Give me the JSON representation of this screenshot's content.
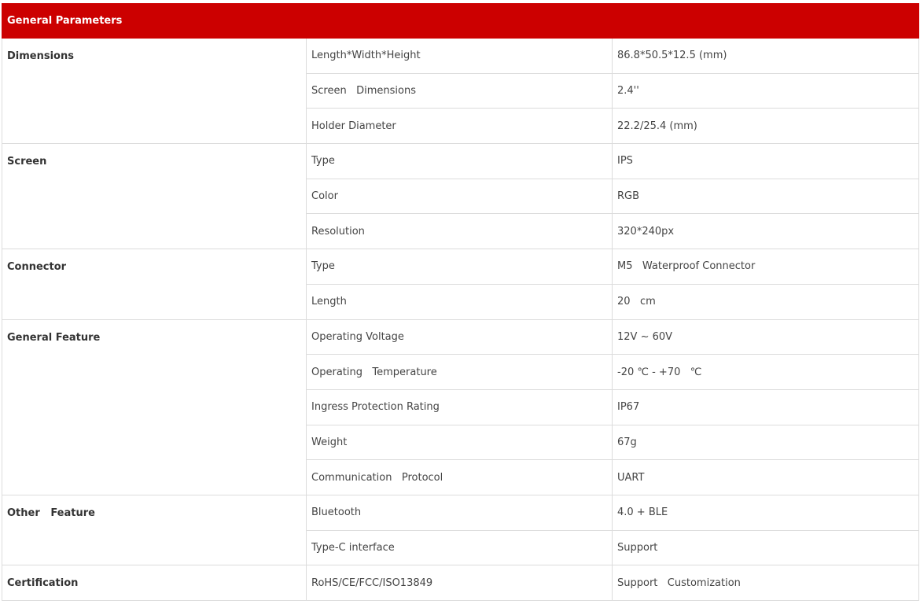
{
  "table": {
    "title": "General Parameters",
    "groups": [
      {
        "name": "Dimensions",
        "rows": [
          {
            "param": "Length*Width*Height",
            "value": "86.8*50.5*12.5 (mm)"
          },
          {
            "param": "Screen   Dimensions",
            "value": "2.4''"
          },
          {
            "param": "Holder Diameter",
            "value": "22.2/25.4 (mm)"
          }
        ]
      },
      {
        "name": "Screen",
        "rows": [
          {
            "param": "Type",
            "value": "IPS"
          },
          {
            "param": "Color",
            "value": "RGB"
          },
          {
            "param": "Resolution",
            "value": "320*240px"
          }
        ]
      },
      {
        "name": "Connector",
        "rows": [
          {
            "param": "Type",
            "value": "M5   Waterproof Connector"
          },
          {
            "param": "Length",
            "value": "20   cm"
          }
        ]
      },
      {
        "name": "General Feature",
        "rows": [
          {
            "param": "Operating Voltage",
            "value": "12V ~ 60V"
          },
          {
            "param": "Operating   Temperature",
            "value": "-20 ℃ - +70   ℃"
          },
          {
            "param": "Ingress Protection Rating",
            "value": "IP67"
          },
          {
            "param": "Weight",
            "value": "67g"
          },
          {
            "param": "Communication   Protocol",
            "value": "UART"
          }
        ]
      },
      {
        "name": "Other   Feature",
        "rows": [
          {
            "param": "Bluetooth",
            "value": "4.0 + BLE"
          },
          {
            "param": "Type-C interface",
            "value": "Support"
          }
        ]
      },
      {
        "name": "Certification",
        "rows": [
          {
            "param": "RoHS/CE/FCC/ISO13849",
            "value": "Support   Customization"
          }
        ]
      }
    ]
  }
}
